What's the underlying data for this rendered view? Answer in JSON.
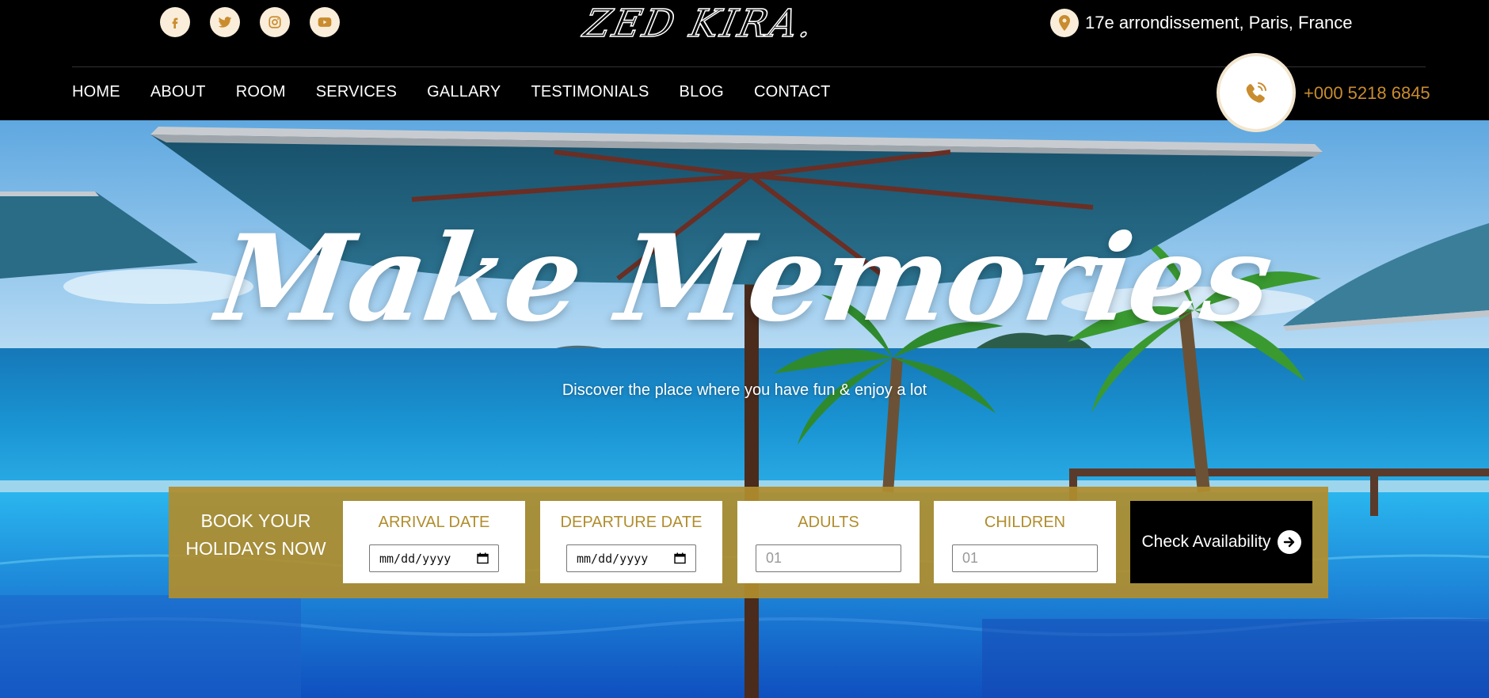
{
  "header": {
    "socials": [
      {
        "name": "facebook-icon"
      },
      {
        "name": "twitter-icon"
      },
      {
        "name": "instagram-icon"
      },
      {
        "name": "youtube-icon"
      }
    ],
    "logo": "ZED KIRA.",
    "address": "17e arrondissement, Paris, France",
    "nav": [
      "HOME",
      "ABOUT",
      "ROOM",
      "SERVICES",
      "GALLARY",
      "TESTIMONIALS",
      "BLOG",
      "CONTACT"
    ],
    "phone": "+000 5218 6845"
  },
  "hero": {
    "headline": "Make Memories",
    "subline": "Discover the place where you have fun & enjoy a lot"
  },
  "booking": {
    "title": "BOOK YOUR HOLIDAYS NOW",
    "arrival": {
      "label": "ARRIVAL DATE",
      "placeholder": "mm/dd/yyyy"
    },
    "departure": {
      "label": "DEPARTURE DATE",
      "placeholder": "mm/dd/yyyy"
    },
    "adults": {
      "label": "ADULTS",
      "placeholder": "01"
    },
    "children": {
      "label": "CHILDREN",
      "placeholder": "01"
    },
    "button": "Check Availability"
  },
  "colors": {
    "accent": "#c98c2e",
    "booking_bg": "#b08d2d",
    "icon_bg": "#faeeda"
  }
}
